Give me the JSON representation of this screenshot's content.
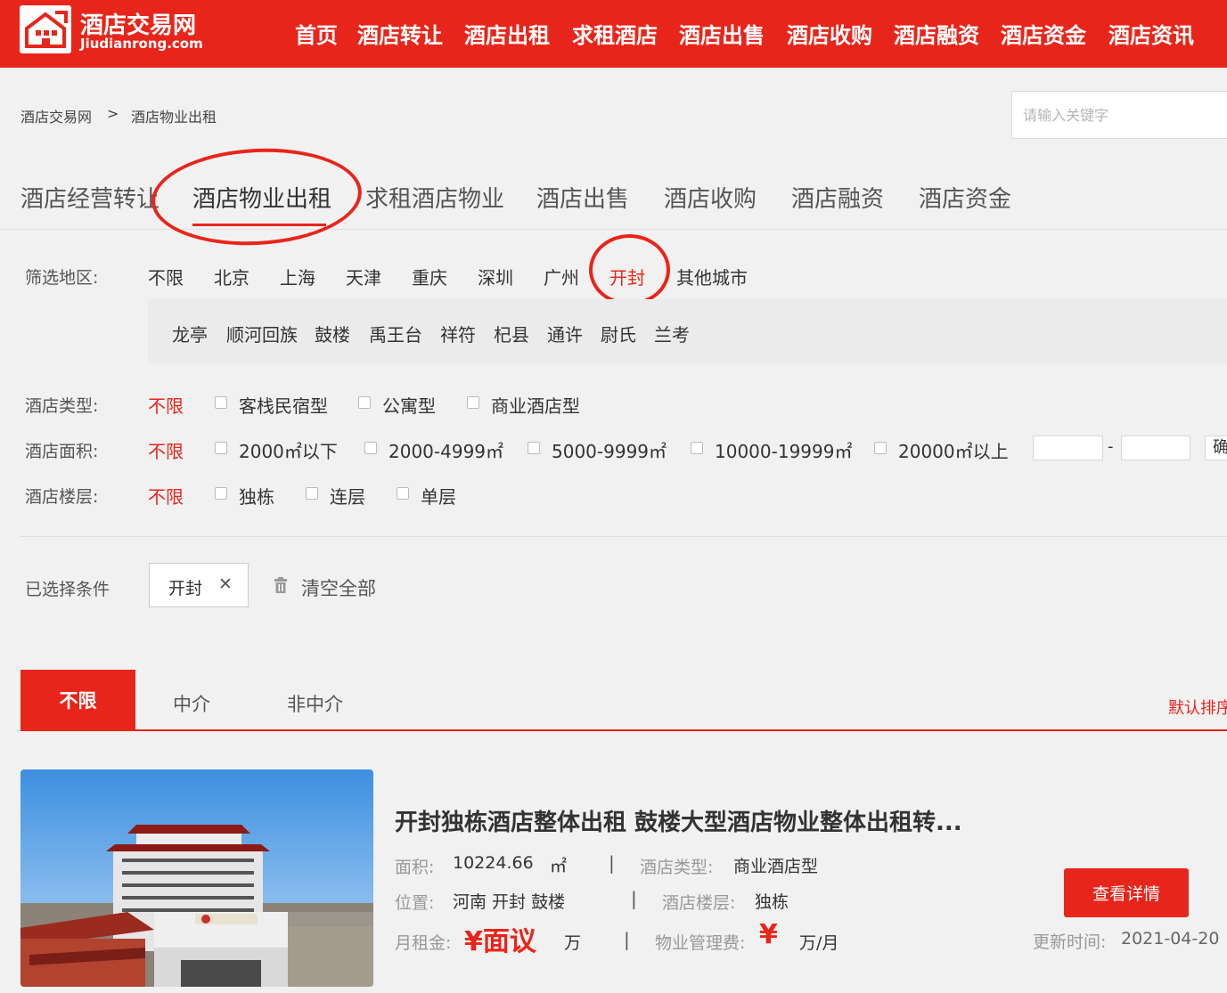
{
  "header": {
    "logo_title": "酒店交易网",
    "logo_sub": "Jiudianrong.com",
    "nav": [
      "首页",
      "酒店转让",
      "酒店出租",
      "求租酒店",
      "酒店出售",
      "酒店收购",
      "酒店融资",
      "酒店资金",
      "酒店资讯"
    ]
  },
  "breadcrumb": {
    "home": "酒店交易网",
    "separator": ">",
    "current": "酒店物业出租"
  },
  "search": {
    "placeholder": "请输入关键字"
  },
  "categories": [
    "酒店经营转让",
    "酒店物业出租",
    "求租酒店物业",
    "酒店出售",
    "酒店收购",
    "酒店融资",
    "酒店资金"
  ],
  "filters": {
    "region": {
      "label": "筛选地区:",
      "options": [
        "不限",
        "北京",
        "上海",
        "天津",
        "重庆",
        "深圳",
        "广州",
        "开封",
        "其他城市"
      ],
      "districts": [
        "龙亭",
        "顺河回族",
        "鼓楼",
        "禹王台",
        "祥符",
        "杞县",
        "通许",
        "尉氏",
        "兰考"
      ]
    },
    "type": {
      "label": "酒店类型:",
      "any": "不限",
      "options": [
        "客栈民宿型",
        "公寓型",
        "商业酒店型"
      ]
    },
    "area": {
      "label": "酒店面积:",
      "any": "不限",
      "options": [
        "2000㎡以下",
        "2000-4999㎡",
        "5000-9999㎡",
        "10000-19999㎡",
        "20000㎡以上"
      ],
      "range_dash": "-",
      "confirm": "确"
    },
    "floors": {
      "label": "酒店楼层:",
      "any": "不限",
      "options": [
        "独栋",
        "连层",
        "单层"
      ]
    }
  },
  "selected": {
    "label": "已选择条件",
    "tag": "开封",
    "remove": "✕",
    "clear_all": "清空全部"
  },
  "result_tabs": [
    "不限",
    "中介",
    "非中介"
  ],
  "sort": "默认排序",
  "listing": {
    "title": "开封独栋酒店整体出租 鼓楼大型酒店物业整体出租转...",
    "area_label": "面积:",
    "area_value": "10224.66",
    "area_unit": "㎡",
    "type_label": "酒店类型:",
    "type_value": "商业酒店型",
    "location_label": "位置:",
    "location_value": "河南 开封 鼓楼",
    "floor_label": "酒店楼层:",
    "floor_value": "独栋",
    "rent_label": "月租金:",
    "rent_value": "¥面议",
    "rent_unit": "万",
    "fee_label": "物业管理费:",
    "fee_value": "¥",
    "fee_unit": "万/月",
    "sep": "|",
    "detail_button": "查看详情",
    "updated_label": "更新时间:",
    "updated_value": "2021-04-20"
  },
  "colors": {
    "brand": "#e8251a"
  }
}
